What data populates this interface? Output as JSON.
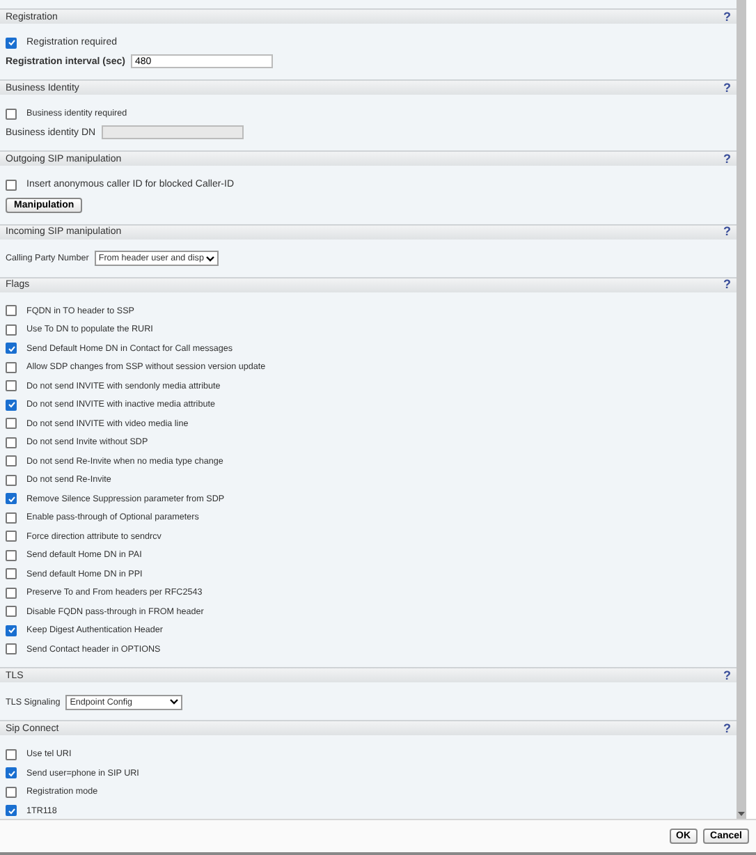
{
  "sections": [
    {
      "title": "Registration",
      "help": "?",
      "items": [
        {
          "kind": "checkbox",
          "label": "Registration required",
          "checked": true
        },
        {
          "kind": "text",
          "label": "Registration interval (sec)",
          "value": "480"
        }
      ]
    },
    {
      "title": "Business Identity",
      "help": "?",
      "items": [
        {
          "kind": "checkbox",
          "label": "Business identity required",
          "checked": false
        },
        {
          "kind": "text",
          "label": "Business identity DN",
          "disabled": true
        }
      ]
    },
    {
      "title": "Outgoing SIP manipulation",
      "help": "?",
      "items": [
        {
          "kind": "checkbox",
          "label": "Insert anonymous caller ID for blocked Caller-ID",
          "checked": false
        },
        {
          "kind": "button",
          "label": "Manipulation"
        }
      ]
    },
    {
      "title": "Incoming SIP manipulation",
      "help": "?",
      "items": [
        {
          "kind": "select",
          "label": "Calling Party Number",
          "value": "From header user and disp"
        }
      ]
    },
    {
      "title": "Flags",
      "help": "?",
      "items": [
        {
          "kind": "checkbox",
          "label": "FQDN in TO header to SSP",
          "checked": false
        },
        {
          "kind": "checkbox",
          "label": "Use To DN to populate the RURI",
          "checked": false
        },
        {
          "kind": "checkbox",
          "label": "Send Default Home DN in Contact for Call messages",
          "checked": true
        },
        {
          "kind": "checkbox",
          "label": "Allow SDP changes from SSP without session version update",
          "checked": false
        },
        {
          "kind": "checkbox",
          "label": "Do not send INVITE with sendonly media attribute",
          "checked": false
        },
        {
          "kind": "checkbox",
          "label": "Do not send INVITE with inactive media attribute",
          "checked": true
        },
        {
          "kind": "checkbox",
          "label": "Do not send INVITE with video media line",
          "checked": false
        },
        {
          "kind": "checkbox",
          "label": "Do not send Invite without SDP",
          "checked": false
        },
        {
          "kind": "checkbox",
          "label": "Do not send Re-Invite when no media type change",
          "checked": false
        },
        {
          "kind": "checkbox",
          "label": "Do not send Re-Invite",
          "checked": false
        },
        {
          "kind": "checkbox",
          "label": "Remove Silence Suppression parameter from SDP",
          "checked": true
        },
        {
          "kind": "checkbox",
          "label": "Enable pass-through of Optional parameters",
          "checked": false
        },
        {
          "kind": "checkbox",
          "label": "Force direction attribute to sendrcv",
          "checked": false
        },
        {
          "kind": "checkbox",
          "label": "Send default Home DN in PAI",
          "checked": false
        },
        {
          "kind": "checkbox",
          "label": "Send default Home DN in PPI",
          "checked": false
        },
        {
          "kind": "checkbox",
          "label": "Preserve To and From headers per RFC2543",
          "checked": false
        },
        {
          "kind": "checkbox",
          "label": "Disable FQDN pass-through in FROM header",
          "checked": false
        },
        {
          "kind": "checkbox",
          "label": "Keep Digest Authentication Header",
          "checked": true
        },
        {
          "kind": "checkbox",
          "label": "Send Contact header in OPTIONS",
          "checked": false
        }
      ]
    },
    {
      "title": "TLS",
      "help": "?",
      "items": [
        {
          "kind": "select",
          "label": "TLS Signaling",
          "value": "Endpoint Config"
        }
      ]
    },
    {
      "title": "Sip Connect",
      "help": "?",
      "items": [
        {
          "kind": "checkbox",
          "label": "Use tel URI",
          "checked": false
        },
        {
          "kind": "checkbox",
          "label": "Send user=phone in SIP URI",
          "checked": true
        },
        {
          "kind": "checkbox",
          "label": "Registration mode",
          "checked": false
        },
        {
          "kind": "checkbox",
          "label": "1TR118",
          "checked": true
        }
      ]
    }
  ],
  "buttons": [
    "OK",
    "Cancel"
  ]
}
